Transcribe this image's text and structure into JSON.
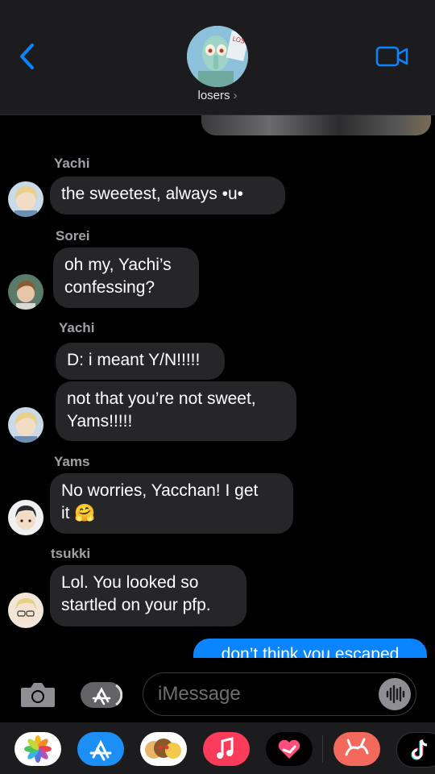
{
  "header": {
    "group_name": "losers",
    "chevron": "›",
    "avatar_text": "LOSER"
  },
  "messages": {
    "m1": {
      "sender": "Yachi",
      "text": "the sweetest, always •u•"
    },
    "m2": {
      "sender": "Sorei",
      "line1": "oh my, Yachi’s",
      "line2": "confessing?"
    },
    "m3": {
      "sender": "Yachi",
      "text": "D: i meant Y/N!!!!!"
    },
    "m4": {
      "line1": "not that you’re not sweet,",
      "line2": "Yams!!!!!"
    },
    "m5": {
      "sender": "Yams",
      "line1": "No worries, Yacchan! I get",
      "line2": "it 🤗"
    },
    "m6": {
      "sender": "tsukki",
      "line1": "Lol. You looked so",
      "line2": "startled on your pfp."
    },
    "outgoing_partial": "don’t think you escaped"
  },
  "composer": {
    "placeholder": "iMessage"
  },
  "colors": {
    "accent": "#0a84ff",
    "bubble": "#262628",
    "header": "#1c1c1e"
  },
  "icons": [
    "back-chevron-icon",
    "video-camera-icon",
    "camera-icon",
    "app-store-icon",
    "audio-waveform-icon",
    "photos-icon",
    "app-store-app-icon",
    "memoji-icon",
    "music-icon",
    "digital-touch-icon",
    "rabbit-app-icon",
    "tiktok-icon"
  ]
}
